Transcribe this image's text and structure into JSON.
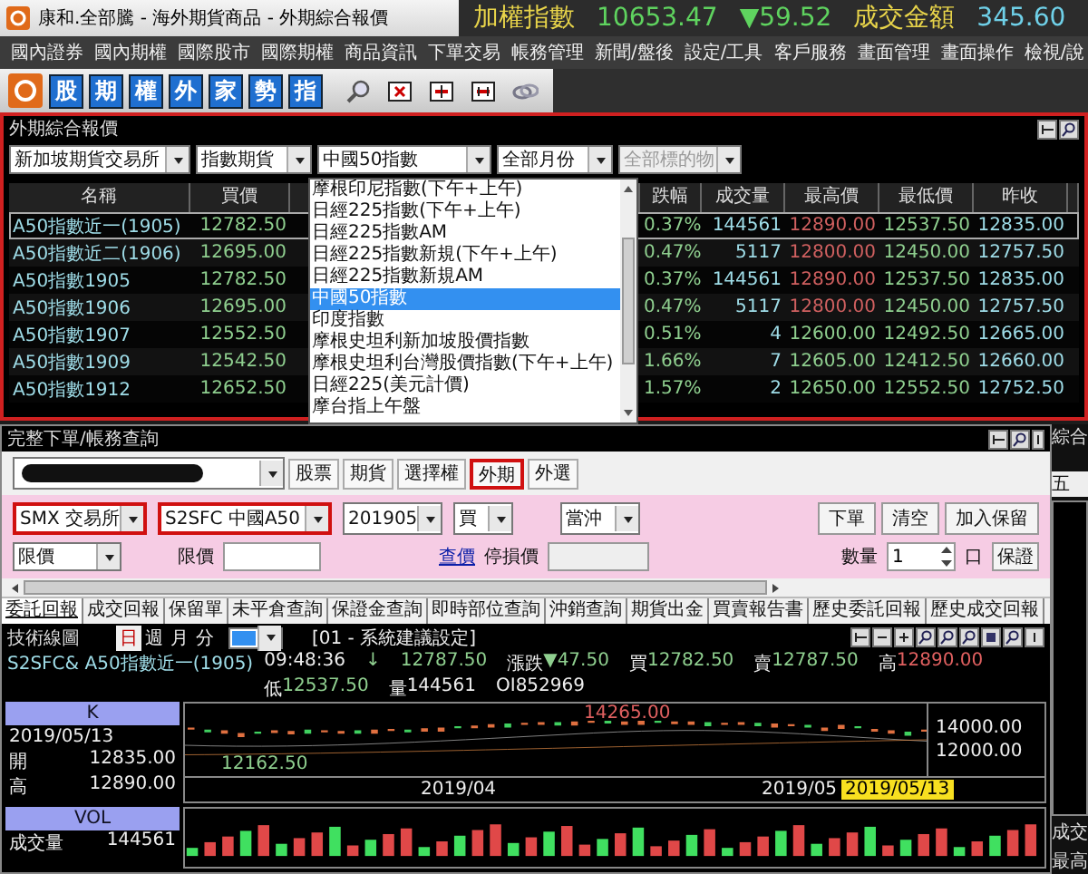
{
  "window": {
    "title": "康和.全部騰 - 海外期貨商品 - 外期綜合報價"
  },
  "ticker": {
    "index_label": "加權指數",
    "index_value": "10653.47",
    "index_change": "▼59.52",
    "turnover_label": "成交金額",
    "turnover_value": "345.60"
  },
  "menu": [
    "國內證券",
    "國內期權",
    "國際股市",
    "國際期權",
    "商品資訊",
    "下單交易",
    "帳務管理",
    "新聞/盤後",
    "設定/工具",
    "客戶服務",
    "畫面管理",
    "畫面操作",
    "檢視/說"
  ],
  "toolbar": [
    "股",
    "期",
    "權",
    "外",
    "家",
    "勢",
    "指"
  ],
  "quote": {
    "title": "外期綜合報價",
    "filters": [
      {
        "value": "新加坡期貨交易所",
        "disabled": false
      },
      {
        "value": "指數期貨",
        "disabled": false
      },
      {
        "value": "中國50指數",
        "disabled": false
      },
      {
        "value": "全部月份",
        "disabled": false
      },
      {
        "value": "全部標的物",
        "disabled": true
      }
    ],
    "columns": [
      "名稱",
      "買價",
      "跌幅",
      "成交量",
      "最高價",
      "最低價",
      "昨收"
    ],
    "rows": [
      {
        "name": "A50指數近一(1905)",
        "bid": "12782.50",
        "pct": "0.37%",
        "volume": "144561",
        "high": "12890.00",
        "high_up": true,
        "low": "12537.50",
        "prev": "12835.00",
        "selected": true
      },
      {
        "name": "A50指數近二(1906)",
        "bid": "12695.00",
        "pct": "0.47%",
        "volume": "5117",
        "high": "12800.00",
        "high_up": true,
        "low": "12450.00",
        "prev": "12757.50",
        "selected": false
      },
      {
        "name": "A50指數1905",
        "bid": "12782.50",
        "pct": "0.37%",
        "volume": "144561",
        "high": "12890.00",
        "high_up": true,
        "low": "12537.50",
        "prev": "12835.00",
        "selected": false
      },
      {
        "name": "A50指數1906",
        "bid": "12695.00",
        "pct": "0.47%",
        "volume": "5117",
        "high": "12800.00",
        "high_up": true,
        "low": "12450.00",
        "prev": "12757.50",
        "selected": false
      },
      {
        "name": "A50指數1907",
        "bid": "12552.50",
        "pct": "0.51%",
        "volume": "4",
        "high": "12600.00",
        "high_up": false,
        "low": "12492.50",
        "prev": "12665.00",
        "selected": false
      },
      {
        "name": "A50指數1909",
        "bid": "12542.50",
        "pct": "1.66%",
        "volume": "7",
        "high": "12605.00",
        "high_up": false,
        "low": "12412.50",
        "prev": "12660.00",
        "selected": false
      },
      {
        "name": "A50指數1912",
        "bid": "12652.50",
        "pct": "1.57%",
        "volume": "2",
        "high": "12650.00",
        "high_up": false,
        "low": "12552.50",
        "prev": "12752.50",
        "selected": false
      }
    ],
    "dropdown": [
      {
        "label": "摩根印尼指數(下午+上午)",
        "selected": false
      },
      {
        "label": "日經225指數(下午+上午)",
        "selected": false
      },
      {
        "label": "日經225指數AM",
        "selected": false
      },
      {
        "label": "日經225指數新規(下午+上午)",
        "selected": false
      },
      {
        "label": "日經225指數新規AM",
        "selected": false
      },
      {
        "label": "中國50指數",
        "selected": true
      },
      {
        "label": "印度指數",
        "selected": false
      },
      {
        "label": "摩根史坦利新加坡股價指數",
        "selected": false
      },
      {
        "label": "摩根史坦利台灣股價指數(下午+上午)",
        "selected": false
      },
      {
        "label": "日經225(美元計價)",
        "selected": false
      },
      {
        "label": "摩台指上午盤",
        "selected": false
      }
    ]
  },
  "order": {
    "title": "完整下單/帳務查詢",
    "markets": [
      {
        "label": "股票",
        "selected": false
      },
      {
        "label": "期貨",
        "selected": false
      },
      {
        "label": "選擇權",
        "selected": false
      },
      {
        "label": "外期",
        "selected": true
      },
      {
        "label": "外選",
        "selected": false
      }
    ],
    "selects": [
      {
        "value": "SMX 交易所",
        "highlighted": true
      },
      {
        "value": "S2SFC  中國A50",
        "highlighted": true
      },
      {
        "value": "201905",
        "highlighted": false
      },
      {
        "value": "買",
        "highlighted": false
      },
      {
        "value": "當沖",
        "highlighted": false
      }
    ],
    "buttons": [
      "下單",
      "清空",
      "加入保留"
    ],
    "price_type": "限價",
    "price_label": "限價",
    "query_link": "查價",
    "stop_label": "停損價",
    "qty_label": "數量",
    "qty_value": "1",
    "qty_unit": "口",
    "margin_button": "保證",
    "tabs": [
      {
        "label": "委託回報",
        "selected": true
      },
      {
        "label": "成交回報",
        "selected": false
      },
      {
        "label": "保留單",
        "selected": false
      },
      {
        "label": "未平倉查詢",
        "selected": false
      },
      {
        "label": "保證金查詢",
        "selected": false
      },
      {
        "label": "即時部位查詢",
        "selected": false
      },
      {
        "label": "沖銷查詢",
        "selected": false
      },
      {
        "label": "期貨出金",
        "selected": false
      },
      {
        "label": "買賣報告書",
        "selected": false
      },
      {
        "label": "歷史委託回報",
        "selected": false
      },
      {
        "label": "歷史成交回報",
        "selected": false
      }
    ]
  },
  "chart": {
    "title": "技術線圖",
    "periods": [
      {
        "label": "日",
        "selected": true
      },
      {
        "label": "週",
        "selected": false
      },
      {
        "label": "月",
        "selected": false
      },
      {
        "label": "分",
        "selected": false
      }
    ],
    "setting": "[01 - 系統建議設定]",
    "symbol": "S2SFC&  A50指數近一(1905)",
    "fields": [
      {
        "value": "09:48:36",
        "kind": "plain"
      },
      {
        "value": "↓",
        "kind": "down"
      },
      {
        "value": "12787.50",
        "kind": "down"
      },
      {
        "label": "漲跌",
        "value": "▼47.50",
        "kind": "down"
      },
      {
        "label": "買",
        "value": "12782.50",
        "kind": "down"
      },
      {
        "label": "賣",
        "value": "12787.50",
        "kind": "down"
      },
      {
        "label": "高",
        "value": "12890.00",
        "kind": "up"
      },
      {
        "label": "低",
        "value": "12537.50",
        "kind": "down"
      },
      {
        "label": "量",
        "value": "144561",
        "kind": "plain"
      },
      {
        "value": "OI852969",
        "kind": "plain"
      }
    ],
    "k_label": "K",
    "date": "2019/05/13",
    "open_label": "開",
    "open_value": "12835.00",
    "high_label": "高",
    "high_value": "12890.00",
    "vol_label": "VOL",
    "vol_name": "成交量",
    "vol_value": "144561",
    "peak": "14265.00",
    "trough": "12162.50",
    "yticks": [
      "14000.00",
      "12000.00"
    ],
    "xlabels": [
      "2019/04",
      "2019/05"
    ],
    "cursor_date": "2019/05/13"
  },
  "side_panel": {
    "title": "綜合",
    "tab": "五",
    "labels": [
      "成交",
      "最高"
    ]
  }
}
